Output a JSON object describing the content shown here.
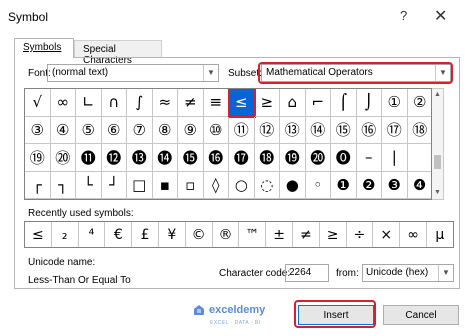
{
  "title": "Symbol",
  "titlebar": {
    "help": "?",
    "close": "✕"
  },
  "tabs": [
    {
      "label": "Symbols"
    },
    {
      "label": "Special Characters"
    }
  ],
  "font": {
    "label": "Font:",
    "value": "(normal text)"
  },
  "subset": {
    "label": "Subset:",
    "value": "Mathematical Operators"
  },
  "grid_symbols": [
    "√",
    "∞",
    "∟",
    "∩",
    "∫",
    "≈",
    "≠",
    "≡",
    "≤",
    "≥",
    "⌂",
    "⌐",
    "⌠",
    "⌡",
    "①",
    "②",
    "③",
    "④",
    "⑤",
    "⑥",
    "⑦",
    "⑧",
    "⑨",
    "⑩",
    "⑪",
    "⑫",
    "⑬",
    "⑭",
    "⑮",
    "⑯",
    "⑰",
    "⑱",
    "⑲",
    "⑳",
    "⓫",
    "⓬",
    "⓭",
    "⓮",
    "⓯",
    "⓰",
    "⓱",
    "⓲",
    "⓳",
    "⓴",
    "⓿",
    "–",
    "|",
    "",
    "┌",
    "┐",
    "└",
    "┘",
    "□",
    "▪",
    "▫",
    "◊",
    "○",
    "◌",
    "●",
    "◦",
    "❶",
    "❷",
    "❸",
    "❹"
  ],
  "selected_index": 8,
  "recent": {
    "label": "Recently used symbols:",
    "symbols": [
      "≤",
      "₂",
      "⁴",
      "€",
      "£",
      "¥",
      "©",
      "®",
      "™",
      "±",
      "≠",
      "≥",
      "÷",
      "×",
      "∞",
      "µ"
    ]
  },
  "unicode_name": {
    "label": "Unicode name:",
    "value": "Less-Than Or Equal To"
  },
  "char_code": {
    "label": "Character code:",
    "value": "2264"
  },
  "from": {
    "label": "from:",
    "value": "Unicode (hex)"
  },
  "buttons": {
    "insert": "Insert",
    "cancel": "Cancel"
  },
  "watermark": {
    "name": "exceldemy",
    "tagline": "EXCEL · DATA · BI"
  },
  "colors": {
    "highlight": "#d9202a",
    "selection": "#0a64d6",
    "accent": "#0078d7"
  }
}
